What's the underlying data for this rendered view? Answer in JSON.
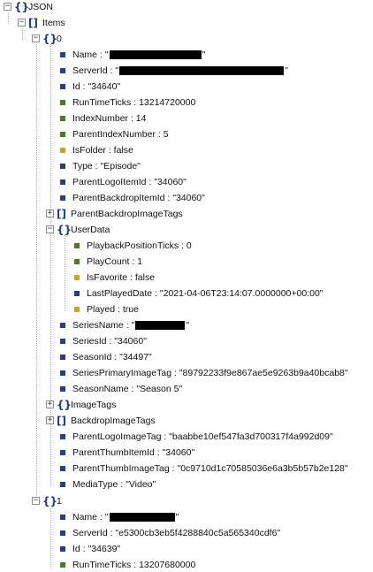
{
  "colors": {
    "leaf_green": "#4a7a2a",
    "leaf_blue": "#2a3f7a",
    "leaf_yellow": "#c9a227"
  },
  "nodes": [
    {
      "label": "JSON"
    },
    {
      "label": "Items"
    },
    {
      "label": "0"
    },
    {
      "label": "Name : \"",
      "suffix": "\""
    },
    {
      "label": "ServerId : \"",
      "suffix": "\""
    },
    {
      "label": "Id : \"34640\""
    },
    {
      "label": "RunTimeTicks : 13214720000"
    },
    {
      "label": "IndexNumber : 14"
    },
    {
      "label": "ParentIndexNumber : 5"
    },
    {
      "label": "IsFolder : false"
    },
    {
      "label": "Type : \"Episode\""
    },
    {
      "label": "ParentLogoItemId : \"34060\""
    },
    {
      "label": "ParentBackdropItemId : \"34060\""
    },
    {
      "label": "ParentBackdropImageTags"
    },
    {
      "label": "UserData"
    },
    {
      "label": "PlaybackPositionTicks : 0"
    },
    {
      "label": "PlayCount : 1"
    },
    {
      "label": "IsFavorite : false"
    },
    {
      "label": "LastPlayedDate : \"2021-04-06T23:14:07.0000000+00:00\""
    },
    {
      "label": "Played : true"
    },
    {
      "label": "SeriesName : \"",
      "suffix": "\""
    },
    {
      "label": "SeriesId : \"34060\""
    },
    {
      "label": "SeasonId : \"34497\""
    },
    {
      "label": "SeriesPrimaryImageTag : \"89792233f9e867ae5e9263b9a40bcab8\""
    },
    {
      "label": "SeasonName : \"Season 5\""
    },
    {
      "label": "ImageTags"
    },
    {
      "label": "BackdropImageTags"
    },
    {
      "label": "ParentLogoImageTag : \"baabbe10ef547fa3d700317f4a992d09\""
    },
    {
      "label": "ParentThumbItemId : \"34060\""
    },
    {
      "label": "ParentThumbImageTag : \"0c9710d1c70585036e6a3b5b57b2e128\""
    },
    {
      "label": "MediaType : \"Video\""
    },
    {
      "label": "1"
    },
    {
      "label": "Name : \"",
      "suffix": "\""
    },
    {
      "label": "ServerId : \"e5300cb3eb5f4288840c5a565340cdf6\""
    },
    {
      "label": "Id : \"34639\""
    },
    {
      "label": "RunTimeTicks : 13207680000"
    }
  ]
}
